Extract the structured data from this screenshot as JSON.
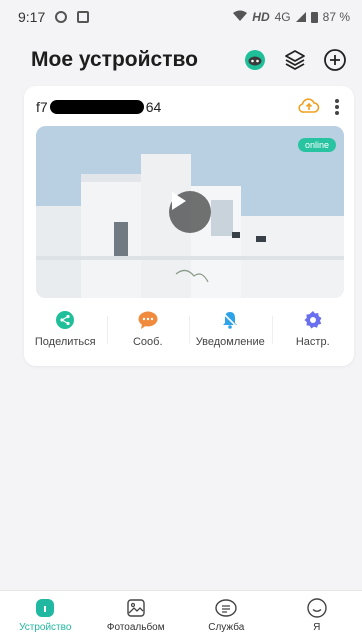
{
  "status_bar": {
    "time": "9:17",
    "network": "HD",
    "signal_label": "4G",
    "battery": "87 %"
  },
  "header": {
    "title": "Мое устройство"
  },
  "device": {
    "name_prefix": "f7",
    "name_suffix": "64",
    "status": "online"
  },
  "quick_actions": [
    {
      "label": "Поделиться",
      "icon": "share-icon",
      "color": "#1fbf9a"
    },
    {
      "label": "Сооб.",
      "icon": "message-icon",
      "color": "#f08a3c"
    },
    {
      "label": "Уведомление",
      "icon": "bell-icon",
      "color": "#2fa3e8"
    },
    {
      "label": "Настр.",
      "icon": "gear-icon",
      "color": "#6a6ff0"
    }
  ],
  "tabs": [
    {
      "label": "Устройство",
      "icon": "home-icon",
      "active": true
    },
    {
      "label": "Фотоальбом",
      "icon": "album-icon",
      "active": false
    },
    {
      "label": "Служба",
      "icon": "service-icon",
      "active": false
    },
    {
      "label": "Я",
      "icon": "profile-icon",
      "active": false
    }
  ],
  "colors": {
    "accent": "#20b8a0",
    "cloud": "#f0a020"
  }
}
